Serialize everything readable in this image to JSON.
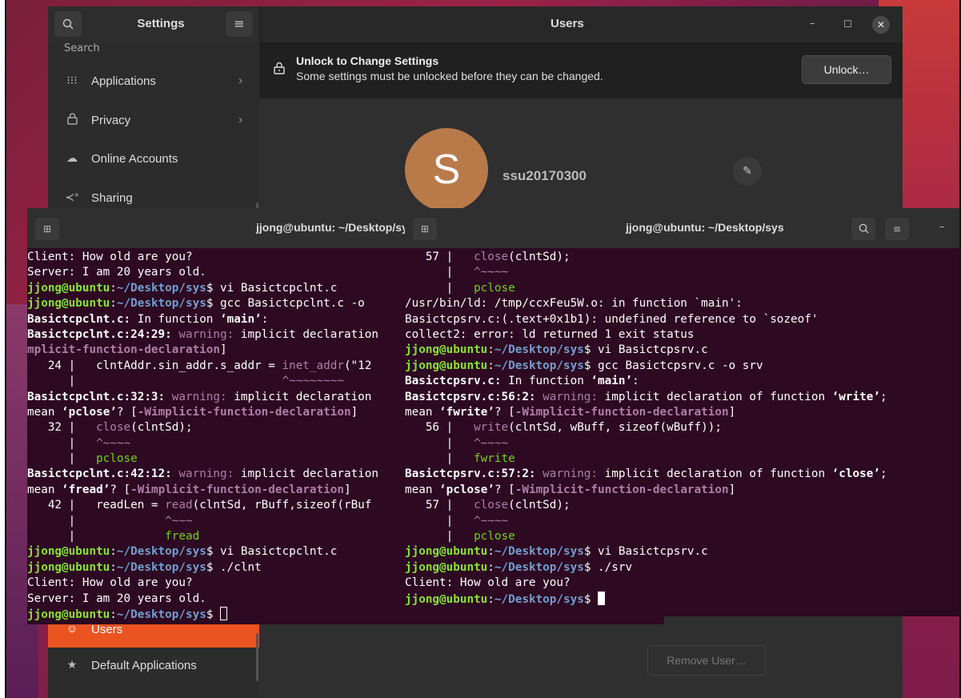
{
  "settings": {
    "title": "Settings",
    "panel_title": "Users",
    "search_icon": "search-icon",
    "menu_icon": "hamburger-icon",
    "sidebar_cut": "Search",
    "sidebar": [
      {
        "label": "Applications",
        "icon": "grid-icon",
        "chevron": "›"
      },
      {
        "label": "Privacy",
        "icon": "lock-icon",
        "chevron": "›"
      },
      {
        "label": "Online Accounts",
        "icon": "cloud-icon"
      },
      {
        "label": "Sharing",
        "icon": "share-icon"
      },
      {
        "label": "Users",
        "icon": "user-icon"
      },
      {
        "label": "Default Applications",
        "icon": "star-icon"
      }
    ],
    "banner": {
      "title": "Unlock to Change Settings",
      "subtitle": "Some settings must be unlocked before they can be changed.",
      "unlock_label": "Unlock…"
    },
    "user": {
      "avatar_letter": "S",
      "username": "ssu20170300",
      "avatar_color": "#b97a4a"
    },
    "remove_label": "Remove User…",
    "accent": "#e95420"
  },
  "terminal_left": {
    "title": "jjong@ubuntu: ~/Desktop/sys",
    "lines": [
      {
        "segs": [
          {
            "t": "Client: How old are you?"
          }
        ]
      },
      {
        "segs": [
          {
            "t": "Server: I am 20 years old."
          }
        ]
      },
      {
        "segs": [
          {
            "t": "jjong@ubuntu",
            "c": "g"
          },
          {
            "t": ":"
          },
          {
            "t": "~/Desktop/sys",
            "c": "b"
          },
          {
            "t": "$ vi Basictcpclnt.c"
          }
        ]
      },
      {
        "segs": [
          {
            "t": "jjong@ubuntu",
            "c": "g"
          },
          {
            "t": ":"
          },
          {
            "t": "~/Desktop/sys",
            "c": "b"
          },
          {
            "t": "$ gcc Basictcpclnt.c -o"
          }
        ]
      },
      {
        "segs": [
          {
            "t": "Basictcpclnt.c:",
            "c": "wb"
          },
          {
            "t": " In function "
          },
          {
            "t": "‘main’",
            "c": "wb"
          },
          {
            "t": ":"
          }
        ]
      },
      {
        "segs": [
          {
            "t": "Basictcpclnt.c:24:29:",
            "c": "wb"
          },
          {
            "t": " "
          },
          {
            "t": "warning:",
            "c": "m"
          },
          {
            "t": " implicit declaration"
          }
        ]
      },
      {
        "segs": [
          {
            "t": "mplicit-function-declaration",
            "c": "mb"
          },
          {
            "t": "]"
          }
        ]
      },
      {
        "segs": [
          {
            "t": "   24 |   clntAddr.sin_addr.s_addr = "
          },
          {
            "t": "inet_addr",
            "c": "m"
          },
          {
            "t": "(\"12"
          }
        ]
      },
      {
        "segs": [
          {
            "t": "      |                              "
          },
          {
            "t": "^~~~~~~~~",
            "c": "m"
          }
        ]
      },
      {
        "segs": [
          {
            "t": "Basictcpclnt.c:32:3:",
            "c": "wb"
          },
          {
            "t": " "
          },
          {
            "t": "warning:",
            "c": "m"
          },
          {
            "t": " implicit declaration"
          }
        ]
      },
      {
        "segs": [
          {
            "t": "mean "
          },
          {
            "t": "‘pclose’",
            "c": "wb"
          },
          {
            "t": "? ["
          },
          {
            "t": "-Wimplicit-function-declaration",
            "c": "mb"
          },
          {
            "t": "]"
          }
        ]
      },
      {
        "segs": [
          {
            "t": "   32 |   "
          },
          {
            "t": "close",
            "c": "m"
          },
          {
            "t": "(clntSd);"
          }
        ]
      },
      {
        "segs": [
          {
            "t": "      |   "
          },
          {
            "t": "^~~~~",
            "c": "m"
          }
        ]
      },
      {
        "segs": [
          {
            "t": "      |   "
          },
          {
            "t": "pclose",
            "c": "gn"
          }
        ]
      },
      {
        "segs": [
          {
            "t": "Basictcpclnt.c:42:12:",
            "c": "wb"
          },
          {
            "t": " "
          },
          {
            "t": "warning:",
            "c": "m"
          },
          {
            "t": " implicit declaration"
          }
        ]
      },
      {
        "segs": [
          {
            "t": "mean "
          },
          {
            "t": "‘fread’",
            "c": "wb"
          },
          {
            "t": "? ["
          },
          {
            "t": "-Wimplicit-function-declaration",
            "c": "mb"
          },
          {
            "t": "]"
          }
        ]
      },
      {
        "segs": [
          {
            "t": "   42 |   readLen = "
          },
          {
            "t": "read",
            "c": "m"
          },
          {
            "t": "(clntSd, rBuff,sizeof(rBuf"
          }
        ]
      },
      {
        "segs": [
          {
            "t": "      |             "
          },
          {
            "t": "^~~~",
            "c": "m"
          }
        ]
      },
      {
        "segs": [
          {
            "t": "      |             "
          },
          {
            "t": "fread",
            "c": "gn"
          }
        ]
      },
      {
        "segs": [
          {
            "t": "jjong@ubuntu",
            "c": "g"
          },
          {
            "t": ":"
          },
          {
            "t": "~/Desktop/sys",
            "c": "b"
          },
          {
            "t": "$ vi Basictcpclnt.c"
          }
        ]
      },
      {
        "segs": [
          {
            "t": "jjong@ubuntu",
            "c": "g"
          },
          {
            "t": ":"
          },
          {
            "t": "~/Desktop/sys",
            "c": "b"
          },
          {
            "t": "$ ./clnt"
          }
        ]
      },
      {
        "segs": [
          {
            "t": "Client: How old are you?"
          }
        ]
      },
      {
        "segs": [
          {
            "t": "Server: I am 20 years old."
          }
        ]
      },
      {
        "segs": [
          {
            "t": "jjong@ubuntu",
            "c": "g"
          },
          {
            "t": ":"
          },
          {
            "t": "~/Desktop/sys",
            "c": "b"
          },
          {
            "t": "$ "
          }
        ],
        "cursor": "outline"
      }
    ]
  },
  "terminal_right": {
    "title": "jjong@ubuntu: ~/Desktop/sys",
    "lines": [
      {
        "segs": [
          {
            "t": "   57 |   "
          },
          {
            "t": "close",
            "c": "m"
          },
          {
            "t": "(clntSd);"
          }
        ]
      },
      {
        "segs": [
          {
            "t": "      |   "
          },
          {
            "t": "^~~~~",
            "c": "m"
          }
        ]
      },
      {
        "segs": [
          {
            "t": "      |   "
          },
          {
            "t": "pclose",
            "c": "gn"
          }
        ]
      },
      {
        "segs": [
          {
            "t": "/usr/bin/ld: /tmp/ccxFeu5W.o: in function `main':"
          }
        ]
      },
      {
        "segs": [
          {
            "t": "Basictcpsrv.c:(.text+0x1b1): undefined reference to `sozeof'"
          }
        ]
      },
      {
        "segs": [
          {
            "t": "collect2: error: ld returned 1 exit status"
          }
        ]
      },
      {
        "segs": [
          {
            "t": "jjong@ubuntu",
            "c": "g"
          },
          {
            "t": ":"
          },
          {
            "t": "~/Desktop/sys",
            "c": "b"
          },
          {
            "t": "$ vi Basictcpsrv.c"
          }
        ]
      },
      {
        "segs": [
          {
            "t": "jjong@ubuntu",
            "c": "g"
          },
          {
            "t": ":"
          },
          {
            "t": "~/Desktop/sys",
            "c": "b"
          },
          {
            "t": "$ gcc Basictcpsrv.c -o srv"
          }
        ]
      },
      {
        "segs": [
          {
            "t": "Basictcpsrv.c:",
            "c": "wb"
          },
          {
            "t": " In function "
          },
          {
            "t": "‘main’",
            "c": "wb"
          },
          {
            "t": ":"
          }
        ]
      },
      {
        "segs": [
          {
            "t": "Basictcpsrv.c:56:2:",
            "c": "wb"
          },
          {
            "t": " "
          },
          {
            "t": "warning:",
            "c": "m"
          },
          {
            "t": " implicit declaration of function "
          },
          {
            "t": "‘write’",
            "c": "wb"
          },
          {
            "t": ";"
          }
        ]
      },
      {
        "segs": [
          {
            "t": "mean "
          },
          {
            "t": "‘fwrite’",
            "c": "wb"
          },
          {
            "t": "? ["
          },
          {
            "t": "-Wimplicit-function-declaration",
            "c": "mb"
          },
          {
            "t": "]"
          }
        ]
      },
      {
        "segs": [
          {
            "t": "   56 |   "
          },
          {
            "t": "write",
            "c": "m"
          },
          {
            "t": "(clntSd, wBuff, sizeof(wBuff));"
          }
        ]
      },
      {
        "segs": [
          {
            "t": "      |   "
          },
          {
            "t": "^~~~~",
            "c": "m"
          }
        ]
      },
      {
        "segs": [
          {
            "t": "      |   "
          },
          {
            "t": "fwrite",
            "c": "gn"
          }
        ]
      },
      {
        "segs": [
          {
            "t": "Basictcpsrv.c:57:2:",
            "c": "wb"
          },
          {
            "t": " "
          },
          {
            "t": "warning:",
            "c": "m"
          },
          {
            "t": " implicit declaration of function "
          },
          {
            "t": "‘close’",
            "c": "wb"
          },
          {
            "t": ";"
          }
        ]
      },
      {
        "segs": [
          {
            "t": "mean "
          },
          {
            "t": "‘pclose’",
            "c": "wb"
          },
          {
            "t": "? ["
          },
          {
            "t": "-Wimplicit-function-declaration",
            "c": "mb"
          },
          {
            "t": "]"
          }
        ]
      },
      {
        "segs": [
          {
            "t": "   57 |   "
          },
          {
            "t": "close",
            "c": "m"
          },
          {
            "t": "(clntSd);"
          }
        ]
      },
      {
        "segs": [
          {
            "t": "      |   "
          },
          {
            "t": "^~~~~",
            "c": "m"
          }
        ]
      },
      {
        "segs": [
          {
            "t": "      |   "
          },
          {
            "t": "pclose",
            "c": "gn"
          }
        ]
      },
      {
        "segs": [
          {
            "t": "jjong@ubuntu",
            "c": "g"
          },
          {
            "t": ":"
          },
          {
            "t": "~/Desktop/sys",
            "c": "b"
          },
          {
            "t": "$ vi Basictcpsrv.c"
          }
        ]
      },
      {
        "segs": [
          {
            "t": "jjong@ubuntu",
            "c": "g"
          },
          {
            "t": ":"
          },
          {
            "t": "~/Desktop/sys",
            "c": "b"
          },
          {
            "t": "$ ./srv"
          }
        ]
      },
      {
        "segs": [
          {
            "t": "Client: How old are you?"
          }
        ]
      },
      {
        "segs": [
          {
            "t": "jjong@ubuntu",
            "c": "g"
          },
          {
            "t": ":"
          },
          {
            "t": "~/Desktop/sys",
            "c": "b"
          },
          {
            "t": "$ "
          }
        ],
        "cursor": "filled"
      }
    ]
  }
}
